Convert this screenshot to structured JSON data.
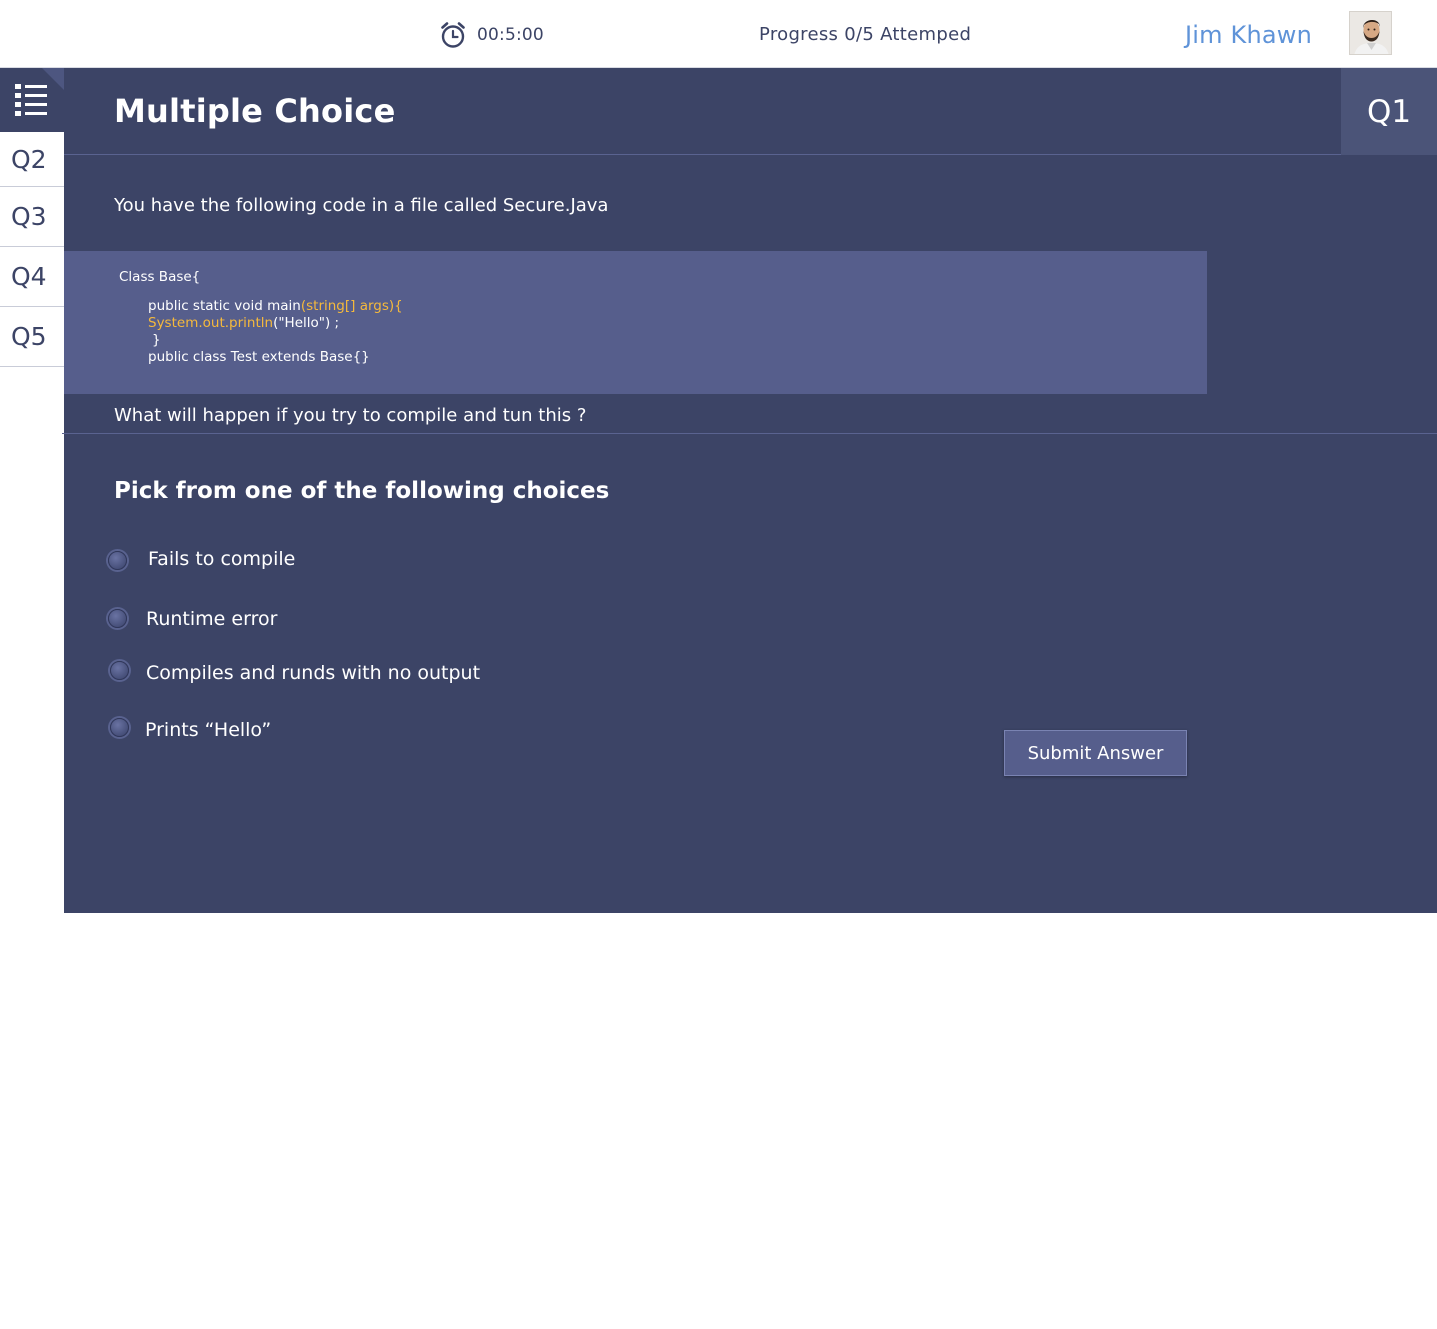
{
  "header": {
    "timer": "00:5:00",
    "progress": "Progress 0/5 Attemped",
    "user_name": "Jim Khawn"
  },
  "sidebar": {
    "items": [
      {
        "label": "Q2"
      },
      {
        "label": "Q3"
      },
      {
        "label": "Q4"
      },
      {
        "label": "Q5"
      }
    ]
  },
  "main": {
    "title": "Multiple Choice",
    "question_number": "Q1",
    "intro": "You have the following code in a file called Secure.Java",
    "code": {
      "line1": "Class Base{",
      "line2_a": "public static void main",
      "line2_b": "(string[] args){",
      "line3_a": "System.out.println",
      "line3_b": "(\"Hello\") ;",
      "line4": "}",
      "line5": "public class Test extends Base{}"
    },
    "question": "What will happen if you try to compile and tun this ?",
    "choices_heading": "Pick from one of the following choices",
    "choices": [
      {
        "label": "Fails to compile",
        "selected": false
      },
      {
        "label": "Runtime error",
        "selected": false
      },
      {
        "label": "Compiles and runds with no output",
        "selected": false
      },
      {
        "label": "Prints “Hello”",
        "selected": false
      }
    ],
    "submit_label": "Submit Answer"
  },
  "colors": {
    "panel": "#3c4466",
    "code_bg": "#565e8c",
    "accent_blue": "#5f93d8",
    "code_highlight": "#f5b93c"
  },
  "icons": {
    "timer": "alarm-clock-icon",
    "menu": "list-menu-icon"
  }
}
